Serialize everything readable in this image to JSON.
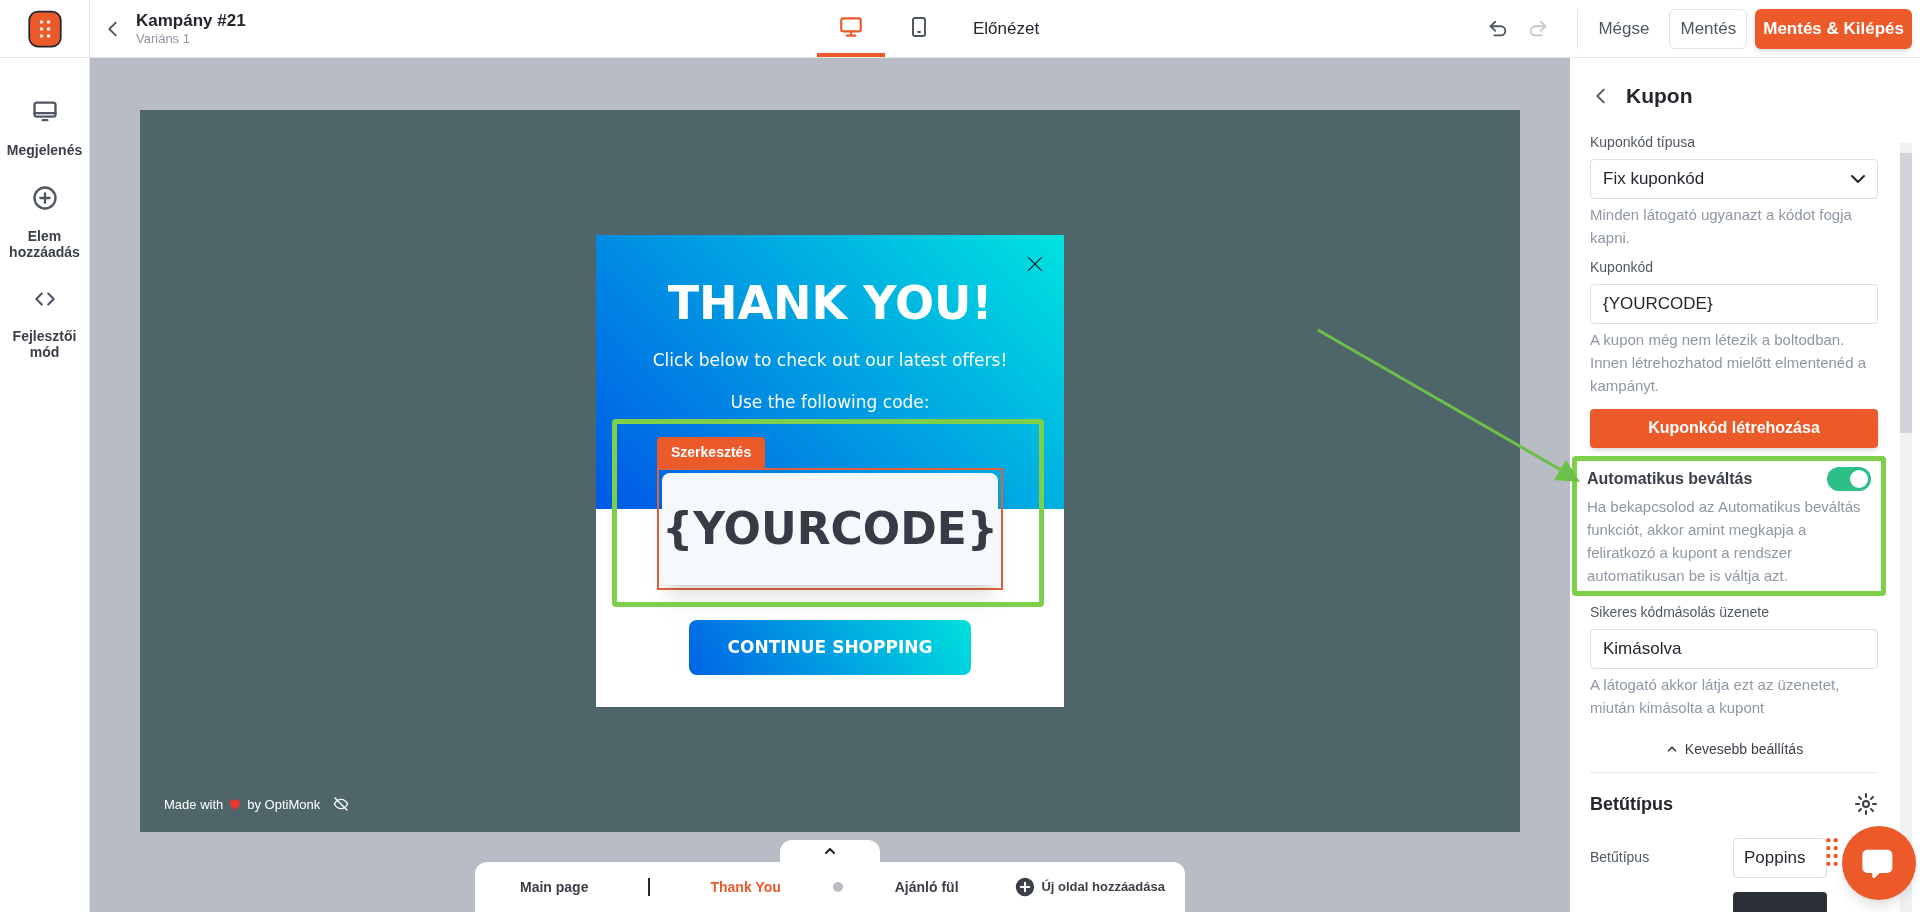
{
  "header": {
    "title": "Kampány #21",
    "subtitle": "Variáns 1",
    "device_tabs": [
      {
        "kind": "desktop",
        "selected": true
      },
      {
        "kind": "mobile",
        "selected": false
      }
    ],
    "preview": "Előnézet",
    "undo": {
      "disabled": false
    },
    "redo": {
      "disabled": true
    },
    "buttons": [
      {
        "kind": "plain",
        "label": "Mégse"
      },
      {
        "kind": "outline",
        "label": "Mentés"
      },
      {
        "kind": "primary",
        "label": "Mentés & Kilépés"
      }
    ]
  },
  "sidebar": {
    "items": [
      {
        "kind": "display",
        "label": "Megjelenés"
      },
      {
        "kind": "add",
        "label": "Elem hozzáadás"
      },
      {
        "kind": "code",
        "label": "Fejlesztői mód"
      }
    ]
  },
  "popup": {
    "title": "THANK YOU!",
    "subtitle": "Click below to check out our latest offers!",
    "code_label": "Use the following code:",
    "edit_tag": "Szerkesztés",
    "code": "{YOURCODE}",
    "button": "CONTINUE SHOPPING"
  },
  "branding": {
    "before": "Made with",
    "after": "by OptiMonk"
  },
  "pages": {
    "items": [
      {
        "label": "Main page",
        "selected": false
      },
      {
        "label": "Thank You",
        "selected": true
      },
      {
        "label": "Ajánló fül",
        "selected": false
      }
    ],
    "add": "Új oldal hozzáadása"
  },
  "panel": {
    "title": "Kupon",
    "fields": [
      {
        "kind": "select",
        "label": "Kuponkód típusa",
        "value": "Fix kuponkód",
        "help": "Minden látogató ugyanazt a kódot fogja kapni."
      },
      {
        "kind": "input",
        "label": "Kuponkód",
        "value": "{YOURCODE}",
        "help": "A kupon még nem létezik a boltodban. Innen létrehozhatod mielőtt elmentenéd a kampányt."
      },
      {
        "kind": "button",
        "label": "Kuponkód létrehozása"
      },
      {
        "kind": "toggle",
        "label": "Automatikus beváltás",
        "on": true,
        "help": "Ha bekapcsolod az Automatikus beváltás funkciót, akkor amint megkapja a feliratkozó a kupont a rendszer automatikusan be is váltja azt."
      },
      {
        "kind": "input",
        "label": "Sikeres kódmásolás üzenete",
        "value": "Kimásolva",
        "help": "A látogató akkor látja ezt az üzenetet, miután kimásolta a kupont"
      }
    ],
    "less_settings": "Kevesebb beállítás",
    "font_section": {
      "title": "Betűtípus",
      "label": "Betűtípus",
      "value": "Poppins"
    }
  }
}
